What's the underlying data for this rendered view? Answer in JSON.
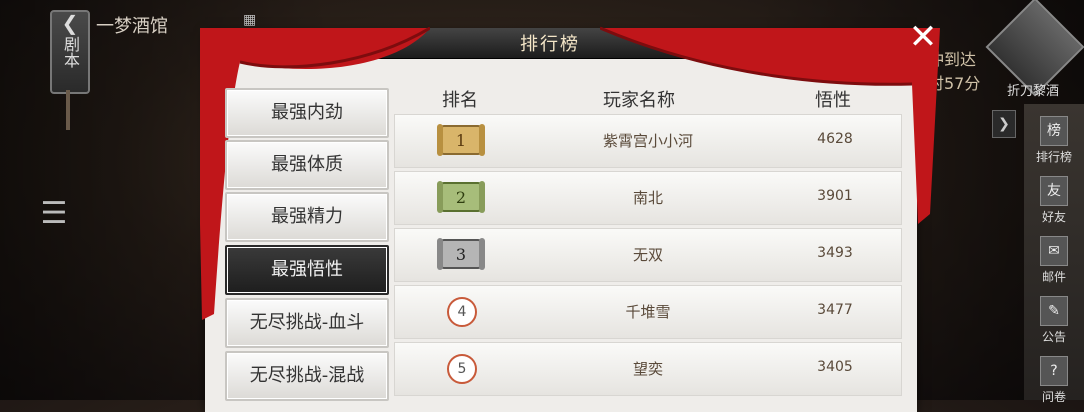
{
  "topbar": {
    "back_label": "剧本",
    "tavern_name": "一梦酒馆"
  },
  "right_status": {
    "line1": "冲到达",
    "line2": "时57分"
  },
  "avatar_label": "折刀黎酒",
  "right_nav": [
    {
      "label": "排行榜",
      "icon": "ranking-icon"
    },
    {
      "label": "好友",
      "icon": "friends-icon"
    },
    {
      "label": "邮件",
      "icon": "mail-icon"
    },
    {
      "label": "公告",
      "icon": "notice-icon"
    },
    {
      "label": "问卷",
      "icon": "survey-icon"
    }
  ],
  "panel": {
    "title": "排行榜"
  },
  "tabs": [
    {
      "label": "最强内劲",
      "active": false
    },
    {
      "label": "最强体质",
      "active": false
    },
    {
      "label": "最强精力",
      "active": false
    },
    {
      "label": "最强悟性",
      "active": true
    },
    {
      "label": "无尽挑战-血斗",
      "active": false
    },
    {
      "label": "无尽挑战-混战",
      "active": false
    }
  ],
  "table": {
    "headers": {
      "rank": "排名",
      "name": "玩家名称",
      "value": "悟性"
    },
    "rows": [
      {
        "rank": "1",
        "name": "紫霄宫小小河",
        "value": "4628",
        "badge": "gold"
      },
      {
        "rank": "2",
        "name": "南北",
        "value": "3901",
        "badge": "green"
      },
      {
        "rank": "3",
        "name": "无双",
        "value": "3493",
        "badge": "silver"
      },
      {
        "rank": "4",
        "name": "千堆雪",
        "value": "3477",
        "badge": "circle"
      },
      {
        "rank": "5",
        "name": "望奕",
        "value": "3405",
        "badge": "circle"
      }
    ]
  },
  "colors": {
    "curtain": "#c0161a",
    "gold": "#d9b56a",
    "green": "#a7bd7a",
    "silver": "#b5b5b5",
    "circle_border": "#c85a3a"
  }
}
